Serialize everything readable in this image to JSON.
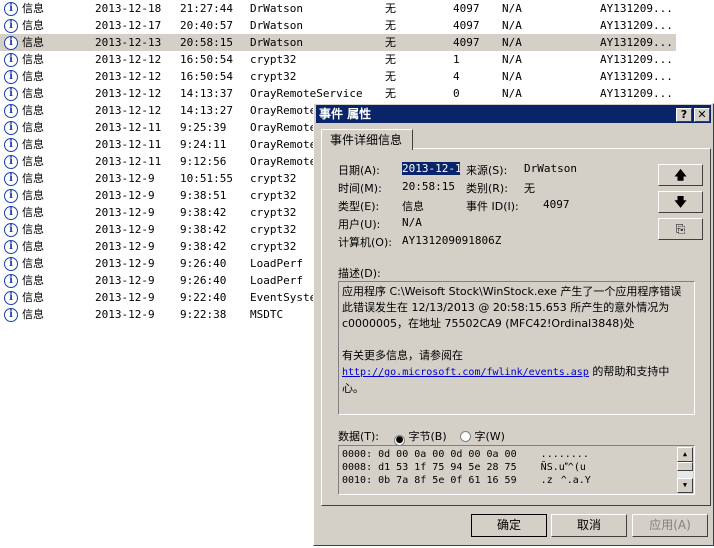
{
  "events": [
    {
      "type": "信息",
      "date": "2013-12-18",
      "time": "21:27:44",
      "source": "DrWatson",
      "category": "无",
      "id": "4097",
      "user": "N/A",
      "computer": "AY131209..."
    },
    {
      "type": "信息",
      "date": "2013-12-17",
      "time": "20:40:57",
      "source": "DrWatson",
      "category": "无",
      "id": "4097",
      "user": "N/A",
      "computer": "AY131209..."
    },
    {
      "type": "信息",
      "date": "2013-12-13",
      "time": "20:58:15",
      "source": "DrWatson",
      "category": "无",
      "id": "4097",
      "user": "N/A",
      "computer": "AY131209..."
    },
    {
      "type": "信息",
      "date": "2013-12-12",
      "time": "16:50:54",
      "source": "crypt32",
      "category": "无",
      "id": "1",
      "user": "N/A",
      "computer": "AY131209..."
    },
    {
      "type": "信息",
      "date": "2013-12-12",
      "time": "16:50:54",
      "source": "crypt32",
      "category": "无",
      "id": "4",
      "user": "N/A",
      "computer": "AY131209..."
    },
    {
      "type": "信息",
      "date": "2013-12-12",
      "time": "14:13:37",
      "source": "OrayRemoteService",
      "category": "无",
      "id": "0",
      "user": "N/A",
      "computer": "AY131209..."
    },
    {
      "type": "信息",
      "date": "2013-12-12",
      "time": "14:13:27",
      "source": "OrayRemoteS"
    },
    {
      "type": "信息",
      "date": "2013-12-11",
      "time": "9:25:39",
      "source": "OrayRemoteS"
    },
    {
      "type": "信息",
      "date": "2013-12-11",
      "time": "9:24:11",
      "source": "OrayRemoteS"
    },
    {
      "type": "信息",
      "date": "2013-12-11",
      "time": "9:12:56",
      "source": "OrayRemoteS"
    },
    {
      "type": "信息",
      "date": "2013-12-9",
      "time": "10:51:55",
      "source": "crypt32"
    },
    {
      "type": "信息",
      "date": "2013-12-9",
      "time": "9:38:51",
      "source": "crypt32"
    },
    {
      "type": "信息",
      "date": "2013-12-9",
      "time": "9:38:42",
      "source": "crypt32"
    },
    {
      "type": "信息",
      "date": "2013-12-9",
      "time": "9:38:42",
      "source": "crypt32"
    },
    {
      "type": "信息",
      "date": "2013-12-9",
      "time": "9:38:42",
      "source": "crypt32"
    },
    {
      "type": "信息",
      "date": "2013-12-9",
      "time": "9:26:40",
      "source": "LoadPerf"
    },
    {
      "type": "信息",
      "date": "2013-12-9",
      "time": "9:26:40",
      "source": "LoadPerf"
    },
    {
      "type": "信息",
      "date": "2013-12-9",
      "time": "9:22:40",
      "source": "EventSyster"
    },
    {
      "type": "信息",
      "date": "2013-12-9",
      "time": "9:22:38",
      "source": "MSDTC"
    }
  ],
  "selected_index": 2,
  "dialog": {
    "title": "事件 属性",
    "help": "?",
    "close": "✕",
    "tab": "事件详细信息",
    "labels": {
      "date": "日期(A):",
      "source": "来源(S):",
      "time": "时间(M):",
      "category": "类别(R):",
      "type": "类型(E):",
      "event_id": "事件 ID(I):",
      "user": "用户(U):",
      "computer": "计算机(O):",
      "description": "描述(D):",
      "data": "数据(T):",
      "bytes": "字节(B)",
      "words": "字(W)"
    },
    "values": {
      "date": "2013-12-13",
      "source": "DrWatson",
      "time": "20:58:15",
      "category": "无",
      "type": "信息",
      "event_id": "4097",
      "user": "N/A",
      "computer": "AY131209091806Z"
    },
    "description": {
      "line1": "应用程序 C:\\Weisoft Stock\\WinStock.exe 产生了一个应用程序错误 此错误发生在 12/13/2013 @ 20:58:15.653 所产生的意外情况为 c0000005，在地址 75502CA9 (MFC42!Ordinal3848)处",
      "line2": "有关更多信息，请参阅在",
      "link": "http://go.microsoft.com/fwlink/events.asp",
      "line3": " 的帮助和支持中心。"
    },
    "data_mode": "bytes",
    "hex": [
      "0000: 0d 00 0a 00 0d 00 0a 00    ........",
      "0008: d1 53 1f 75 94 5e 28 75    ÑS.u^(u",
      "0010: 0b 7a 8f 5e 0f 61 16 59    .z^.a.Y"
    ],
    "buttons": {
      "ok": "确定",
      "cancel": "取消",
      "apply": "应用(A)"
    },
    "icons": {
      "up": "arrow-up-icon",
      "down": "arrow-down-icon",
      "copy": "copy-icon"
    }
  }
}
